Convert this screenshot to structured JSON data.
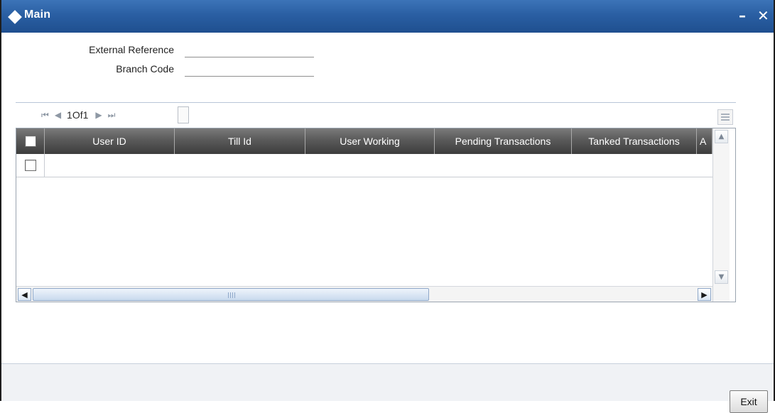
{
  "window": {
    "title": "Main",
    "minimize_glyph": "–",
    "close_glyph": "✕"
  },
  "form": {
    "external_reference": {
      "label": "External Reference",
      "value": ""
    },
    "branch_code": {
      "label": "Branch Code",
      "value": ""
    }
  },
  "pager": {
    "first_glyph": "⏮",
    "prev_glyph": "◀",
    "page_text": "1Of1",
    "next_glyph": "▶",
    "last_glyph": "⏭"
  },
  "table": {
    "columns": [
      "User ID",
      "Till Id",
      "User Working",
      "Pending Transactions",
      "Tanked Transactions",
      "A"
    ],
    "rows": [
      {
        "checked": false,
        "cells": [
          "",
          "",
          "",
          "",
          "",
          ""
        ]
      }
    ]
  },
  "scrollbars": {
    "up_glyph": "▲",
    "down_glyph": "▼",
    "left_glyph": "◀",
    "right_glyph": "▶"
  },
  "footer": {
    "exit_label": "Exit"
  },
  "icons": {
    "title": "diamond-icon",
    "grid_settings": "list-settings-icon"
  }
}
